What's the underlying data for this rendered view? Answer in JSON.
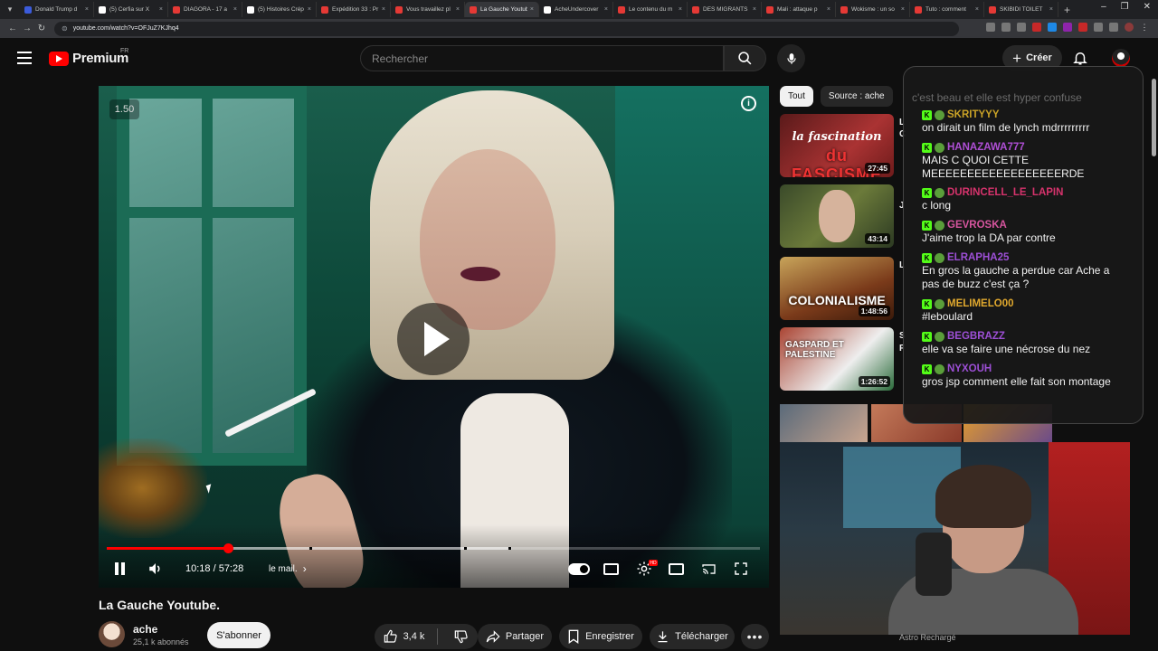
{
  "browser": {
    "tabs": [
      {
        "label": "Donald Trump d",
        "color": "#3b5bdb",
        "active": false
      },
      {
        "label": "(5) Cerfia sur X",
        "color": "#ffffff",
        "active": false
      },
      {
        "label": "DIAGORA - 17 a",
        "color": "#e53935",
        "active": false
      },
      {
        "label": "(5) Histoires Crép",
        "color": "#ffffff",
        "active": false
      },
      {
        "label": "Expédition 33 : Pr",
        "color": "#e53935",
        "active": false
      },
      {
        "label": "Vous travaillez pl",
        "color": "#e53935",
        "active": false
      },
      {
        "label": "La Gauche Youtub",
        "color": "#e53935",
        "active": true
      },
      {
        "label": "AcheUndercover",
        "color": "#ffffff",
        "active": false
      },
      {
        "label": "Le contenu du m",
        "color": "#e53935",
        "active": false
      },
      {
        "label": "DES MIGRANTS",
        "color": "#e53935",
        "active": false
      },
      {
        "label": "Mali : attaque p",
        "color": "#e53935",
        "active": false
      },
      {
        "label": "Wokisme : un so",
        "color": "#e53935",
        "active": false
      },
      {
        "label": "Tuto : comment",
        "color": "#e53935",
        "active": false
      },
      {
        "label": "SKIBIDI TOILET",
        "color": "#e53935",
        "active": false
      }
    ],
    "url": "youtube.com/watch?v=OFJuZ7KJhq4"
  },
  "header": {
    "logo": "Premium",
    "country": "FR",
    "search_placeholder": "Rechercher",
    "create_label": "Créer"
  },
  "player": {
    "speed": "1.50",
    "time": "10:18 / 57:28",
    "chapter": "le mail.",
    "progress_fraction": 0.185,
    "buffer_fraction": 0.62
  },
  "video": {
    "title": "La Gauche Youtube.",
    "channel": "ache",
    "subscribers": "25,1 k abonnés",
    "subscribe_label": "S'abonner",
    "likes": "3,4 k",
    "share_label": "Partager",
    "save_label": "Enregistrer",
    "download_label": "Télécharger"
  },
  "chips": [
    "Tout",
    "Source : ache"
  ],
  "related": [
    {
      "duration": "27:45",
      "thumb_line1": "la fascination",
      "thumb_line2": "du FASCISME"
    },
    {
      "duration": "43:14"
    },
    {
      "duration": "1:48:56",
      "thumb_line1": "COLONIALISME"
    },
    {
      "duration": "1:26:52",
      "thumb_line1": "GASPARD ET PALESTINE"
    }
  ],
  "related_fragments": [
    "L",
    "C",
    "J",
    "L",
    "S",
    "F"
  ],
  "chat": {
    "faded_line": "c'est beau et elle est hyper confuse",
    "messages": [
      {
        "nick": "SKRITYYY",
        "color": "#c9a227",
        "text": "on dirait un film de lynch mdrrrrrrrrr"
      },
      {
        "nick": "HANAZAWA777",
        "color": "#b04fd6",
        "text": "MAIS C QUOI CETTE MEEEEEEEEEEEEEEEEEERDE"
      },
      {
        "nick": "DURINCELL_LE_LAPIN",
        "color": "#d6336c",
        "text": "c long"
      },
      {
        "nick": "GEVROSKA",
        "color": "#d6559e",
        "text": "J'aime trop la DA par contre"
      },
      {
        "nick": "ELRAPHA25",
        "color": "#9d4fd6",
        "text": "En gros la gauche a perdue car Ache a pas de buzz c'est ça ?"
      },
      {
        "nick": "MELIMELO00",
        "color": "#e0a82e",
        "text": "#leboulard"
      },
      {
        "nick": "BEGBRAZZ",
        "color": "#9d4fd6",
        "text": "elle va se faire une nécrose du nez"
      },
      {
        "nick": "NYXOUH",
        "color": "#9d4fd6",
        "text": "gros jsp comment elle fait son montage"
      }
    ]
  },
  "webcam": {
    "label": "Astro Rechargé"
  },
  "colors": {
    "accent": "#ff0000",
    "kick_green": "#53fc18"
  }
}
